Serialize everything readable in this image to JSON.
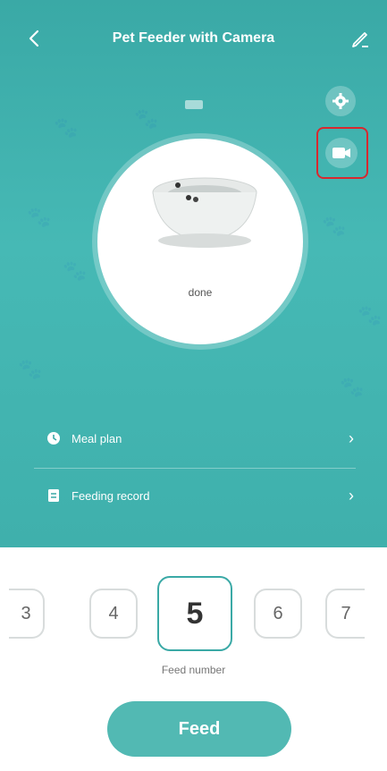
{
  "header": {
    "title": "Pet Feeder with Camera"
  },
  "feeder": {
    "status": "done"
  },
  "menu": {
    "meal_plan_label": "Meal plan",
    "feeding_record_label": "Feeding record"
  },
  "picker": {
    "numbers": [
      "3",
      "4",
      "5",
      "6",
      "7"
    ],
    "selected": "5",
    "label": "Feed number"
  },
  "actions": {
    "feed_label": "Feed"
  },
  "colors": {
    "accent": "#3aa9a6",
    "highlight": "#d8282f"
  },
  "icons": [
    "back-arrow-icon",
    "edit-icon",
    "battery-icon",
    "gear-icon",
    "video-camera-icon",
    "clock-icon",
    "record-icon",
    "chevron-right-icon"
  ]
}
